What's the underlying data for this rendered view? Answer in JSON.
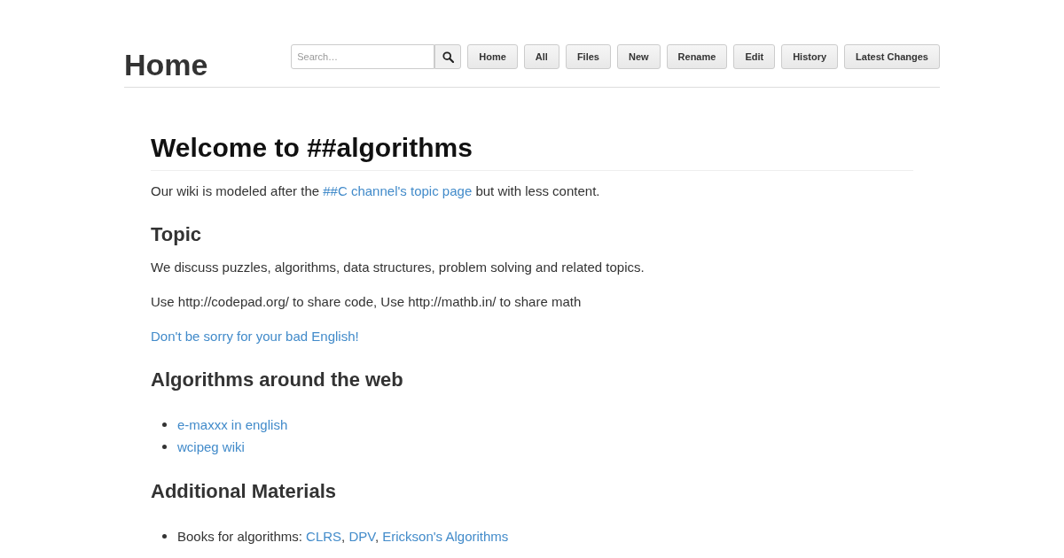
{
  "header": {
    "title": "Home",
    "search": {
      "placeholder": "Search…"
    },
    "nav": [
      "Home",
      "All",
      "Files",
      "New",
      "Rename",
      "Edit",
      "History",
      "Latest Changes"
    ]
  },
  "content": [
    {
      "kind": "h1",
      "text": "Welcome to ##algorithms"
    },
    {
      "kind": "p",
      "parts": [
        {
          "text": "Our wiki is modeled after the ",
          "link": false
        },
        {
          "text": "##C channel's topic page",
          "link": true
        },
        {
          "text": " but with less content.",
          "link": false
        }
      ]
    },
    {
      "kind": "h2",
      "text": "Topic"
    },
    {
      "kind": "p",
      "parts": [
        {
          "text": "We discuss puzzles, algorithms, data structures, problem solving and related topics.",
          "link": false
        }
      ]
    },
    {
      "kind": "p",
      "parts": [
        {
          "text": "Use http://codepad.org/ to share code, Use http://mathb.in/ to share math",
          "link": false
        }
      ]
    },
    {
      "kind": "p",
      "parts": [
        {
          "text": "Don't be sorry for your bad English!",
          "link": true
        }
      ]
    },
    {
      "kind": "h2",
      "text": "Algorithms around the web"
    },
    {
      "kind": "list",
      "items": [
        [
          {
            "text": "e-maxxx in english",
            "link": true
          }
        ],
        [
          {
            "text": "wcipeg wiki",
            "link": true
          }
        ]
      ]
    },
    {
      "kind": "h2",
      "text": "Additional Materials"
    },
    {
      "kind": "list",
      "items": [
        [
          {
            "text": "Books for algorithms: ",
            "link": false
          },
          {
            "text": "CLRS",
            "link": true
          },
          {
            "text": ", ",
            "link": false
          },
          {
            "text": "DPV",
            "link": true
          },
          {
            "text": ", ",
            "link": false
          },
          {
            "text": "Erickson's Algorithms",
            "link": true
          }
        ]
      ]
    }
  ]
}
